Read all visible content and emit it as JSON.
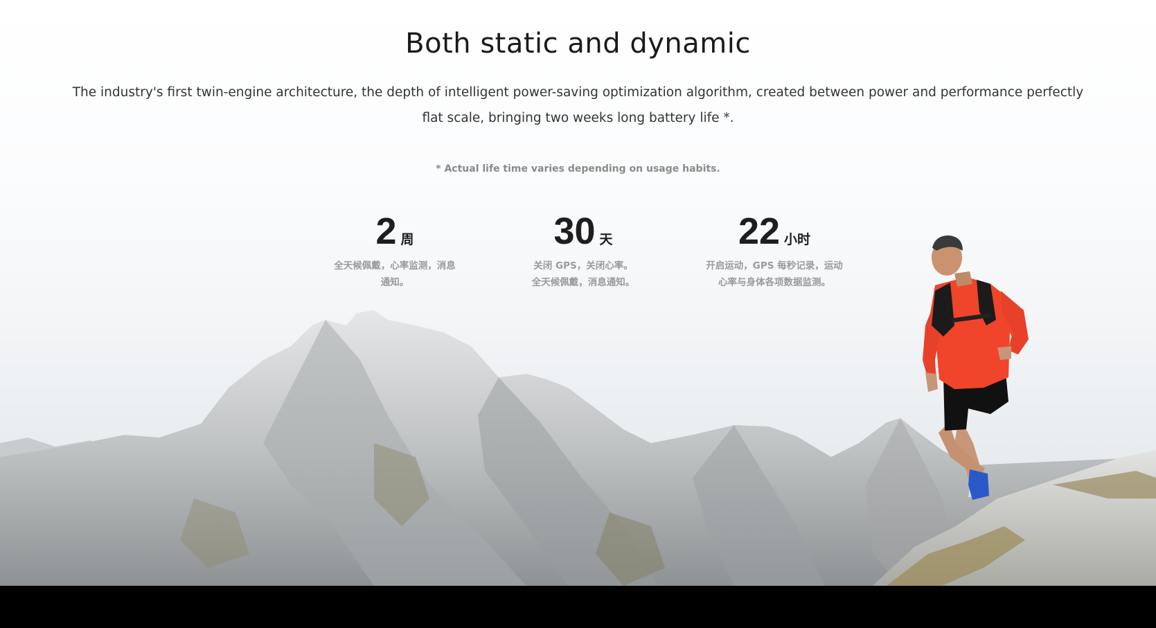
{
  "section": {
    "title": "Both static and dynamic",
    "description": "The industry's first twin-engine architecture, the depth of intelligent power-saving optimization algorithm, created between power and performance perfectly flat scale, bringing two weeks long battery life *.",
    "note": "* Actual life time varies depending on usage habits."
  },
  "stats": [
    {
      "value": "2",
      "unit": "周",
      "desc_line1": "全天候佩戴，心率监测，消息",
      "desc_line2": "通知。"
    },
    {
      "value": "30",
      "unit": "天",
      "desc_line1": "关闭 GPS，关闭心率。",
      "desc_line2": "全天候佩戴，消息通知。"
    },
    {
      "value": "22",
      "unit": "小时",
      "desc_line1": "开启运动，GPS 每秒记录，运动",
      "desc_line2": "心率与身体各项数据监测。"
    }
  ],
  "colors": {
    "runner_jacket": "#f0452a",
    "shorts": "#111111",
    "shoes": "#2a58c8",
    "rock": "#b9bcbd"
  }
}
